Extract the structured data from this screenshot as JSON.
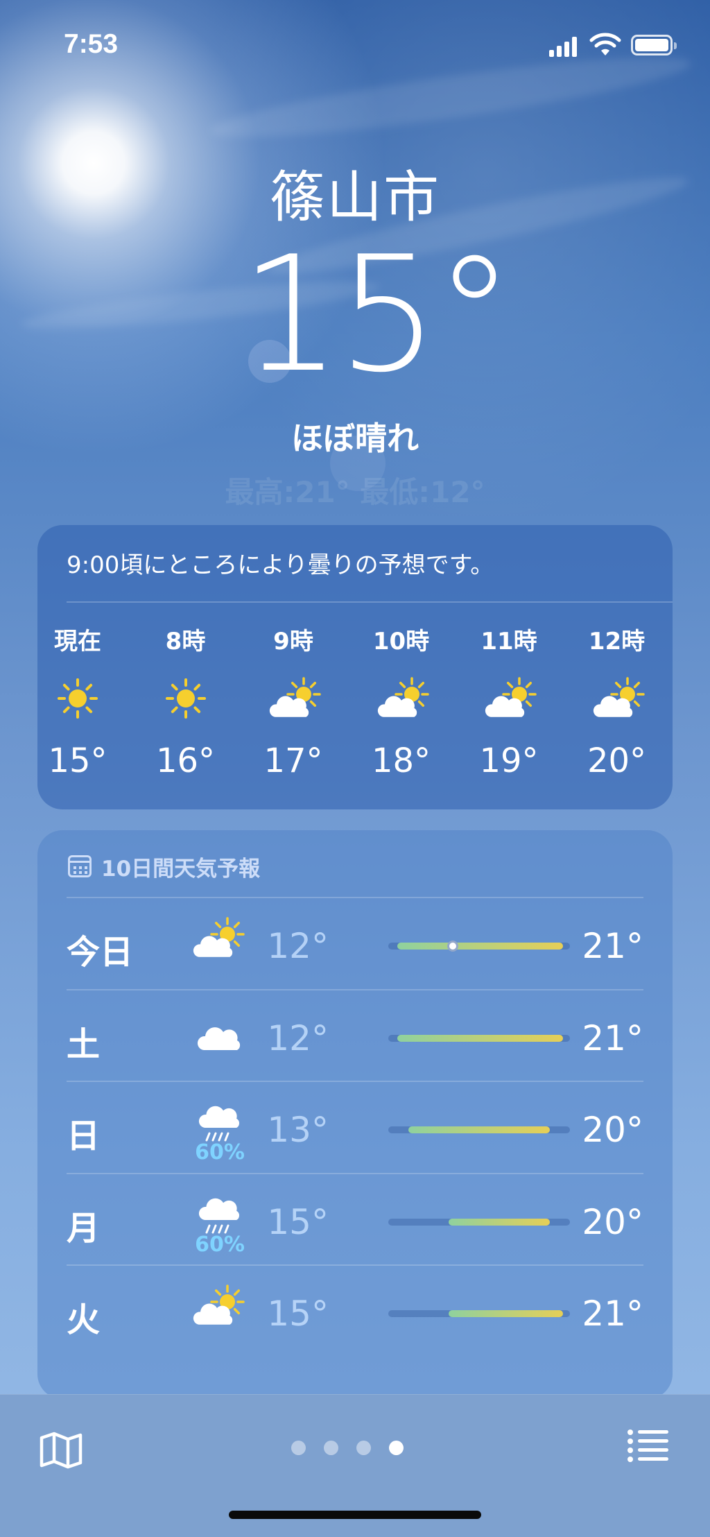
{
  "status_bar": {
    "time": "7:53"
  },
  "hero": {
    "city": "篠山市",
    "temperature": "15°",
    "condition": "ほぼ晴れ",
    "high_low": "最高:21°  最低:12°"
  },
  "hourly": {
    "summary": "9:00頃にところにより曇りの予想です。",
    "items": [
      {
        "label": "現在",
        "icon": "sun-icon",
        "temp": "15°"
      },
      {
        "label": "8時",
        "icon": "sun-icon",
        "temp": "16°"
      },
      {
        "label": "9時",
        "icon": "partly-cloudy-icon",
        "temp": "17°"
      },
      {
        "label": "10時",
        "icon": "partly-cloudy-icon",
        "temp": "18°"
      },
      {
        "label": "11時",
        "icon": "partly-cloudy-icon",
        "temp": "19°"
      },
      {
        "label": "12時",
        "icon": "partly-cloudy-icon",
        "temp": "20°"
      }
    ]
  },
  "daily": {
    "header": "10日間天気予報",
    "range_min": 12,
    "range_max": 21,
    "items": [
      {
        "day": "今日",
        "icon": "partly-cloudy-icon",
        "precip": "",
        "low": "12°",
        "high": "21°",
        "low_value": 12,
        "high_value": 21,
        "current_value": 15
      },
      {
        "day": "土",
        "icon": "cloud-icon",
        "precip": "",
        "low": "12°",
        "high": "21°",
        "low_value": 12,
        "high_value": 21
      },
      {
        "day": "日",
        "icon": "rain-icon",
        "precip": "60%",
        "low": "13°",
        "high": "20°",
        "low_value": 13,
        "high_value": 20
      },
      {
        "day": "月",
        "icon": "rain-icon",
        "precip": "60%",
        "low": "15°",
        "high": "20°",
        "low_value": 15,
        "high_value": 20
      },
      {
        "day": "火",
        "icon": "partly-cloudy-icon",
        "precip": "",
        "low": "15°",
        "high": "21°",
        "low_value": 15,
        "high_value": 21
      }
    ]
  },
  "pager": {
    "count": 4,
    "active_index": 3
  },
  "colors": {
    "cool": "#8fd19e",
    "warm": "#e6cf57",
    "sun": "#f6cf2e",
    "precip": "#7fd3ff"
  }
}
